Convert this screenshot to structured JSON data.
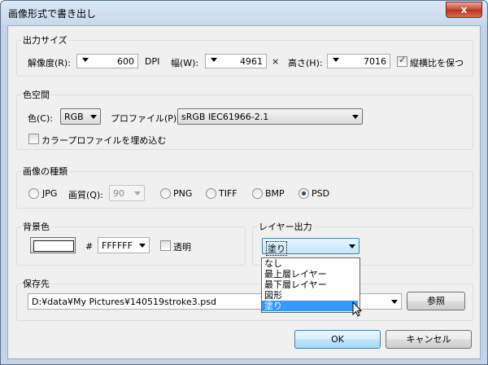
{
  "window": {
    "title": "画像形式で書き出し",
    "close_glyph": "x"
  },
  "output_size": {
    "label": "出力サイズ",
    "resolution_label": "解像度(R):",
    "resolution_value": "600",
    "dpi_unit": "DPI",
    "width_label": "幅(W):",
    "width_value": "4961",
    "times": "×",
    "height_label": "高さ(H):",
    "height_value": "7016",
    "keep_ratio_label": "縦横比を保つ",
    "keep_ratio_checked": true
  },
  "color_space": {
    "label": "色空間",
    "color_label": "色(C):",
    "color_value": "RGB",
    "profile_label": "プロファイル(P):",
    "profile_value": "sRGB IEC61966-2.1",
    "embed_label": "カラープロファイルを埋め込む",
    "embed_checked": false
  },
  "image_type": {
    "label": "画像の種類",
    "jpg": "JPG",
    "quality_label": "画質(Q):",
    "quality_value": "90",
    "png": "PNG",
    "tiff": "TIFF",
    "bmp": "BMP",
    "psd": "PSD",
    "selected": "PSD"
  },
  "background": {
    "label": "背景色",
    "hash": "#",
    "hex_value": "FFFFFF",
    "transparent_label": "透明",
    "transparent_checked": false,
    "swatch_color": "#ffffff"
  },
  "layer_output": {
    "label": "レイヤー出力",
    "value": "塗り",
    "options": [
      "なし",
      "最上層レイヤー",
      "最下層レイヤー",
      "図形",
      "塗り"
    ],
    "highlighted": "塗り"
  },
  "save_to": {
    "label": "保存先",
    "path": "D:¥data¥My Pictures¥140519stroke3.psd",
    "browse_label": "参照"
  },
  "buttons": {
    "ok": "OK",
    "cancel": "キャンセル"
  },
  "colors": {
    "selection": "#3399ff",
    "title_bar": "#c3d4ea",
    "close_button": "#c7452f"
  },
  "icons": [
    "close-icon",
    "checkbox-checked-icon",
    "radio-selected-icon",
    "dropdown-arrow-icon",
    "mouse-cursor-icon"
  ]
}
